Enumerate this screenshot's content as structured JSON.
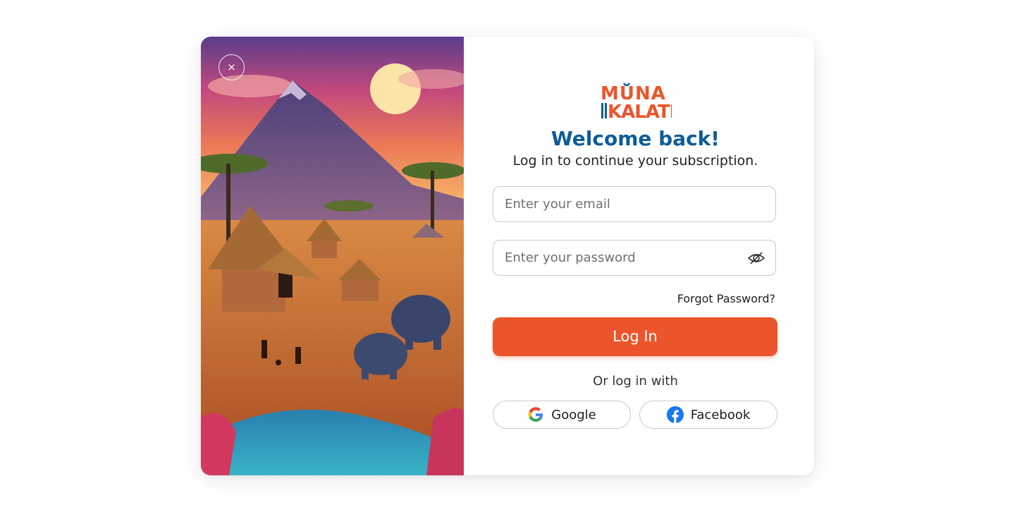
{
  "close_label": "×",
  "brand": {
    "logo_line1": "MUNA",
    "logo_line2": "KALATI"
  },
  "title": "Welcome back!",
  "subtitle": "Log in to continue your subscription.",
  "email": {
    "placeholder": "Enter your email",
    "value": ""
  },
  "password": {
    "placeholder": "Enter your password",
    "value": "",
    "toggle_icon": "eye-off-icon"
  },
  "forgot_label": "Forgot Password?",
  "login_label": "Log In",
  "alt_login_label": "Or log in with",
  "social": [
    {
      "label": "Google",
      "icon": "google-icon"
    },
    {
      "label": "Facebook",
      "icon": "facebook-icon"
    }
  ],
  "colors": {
    "accent": "#ec552b",
    "title": "#0d5d96",
    "border": "#c9c9c9"
  }
}
